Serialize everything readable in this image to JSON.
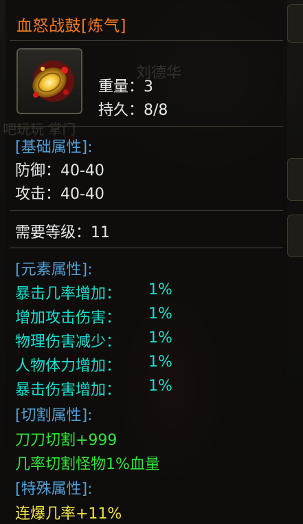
{
  "item": {
    "name": "血怒战鼓[炼气]",
    "watermark_name": "刘德华",
    "watermark_text": "吧玩玩 掌门",
    "weight": "重量：3",
    "durability": "持久：8/8"
  },
  "base": {
    "header": "[基础属性]:",
    "defense": "防御：40-40",
    "attack": "攻击：40-40"
  },
  "requirement": "需要等级：11",
  "elemental": {
    "header": "[元素属性]:",
    "items": [
      {
        "label": "暴击几率增加：",
        "value": "1%"
      },
      {
        "label": "增加攻击伤害：",
        "value": "1%"
      },
      {
        "label": "物理伤害减少：",
        "value": "1%"
      },
      {
        "label": "人物体力增加：",
        "value": "1%"
      },
      {
        "label": "暴击伤害增加：",
        "value": "1%"
      }
    ]
  },
  "cutting": {
    "header": "[切割属性]:",
    "items": [
      "刀刀切割+999",
      "几率切割怪物1%血量"
    ]
  },
  "special": {
    "header": "[特殊属性]:",
    "items": [
      "连爆几率+11%"
    ]
  },
  "colors": {
    "title": "#f07a22",
    "header": "#52a0d8",
    "elemental": "#18e0d0",
    "cutting": "#2ee43a",
    "special": "#f2e642"
  },
  "icons": {
    "item": "war-drum-icon"
  }
}
